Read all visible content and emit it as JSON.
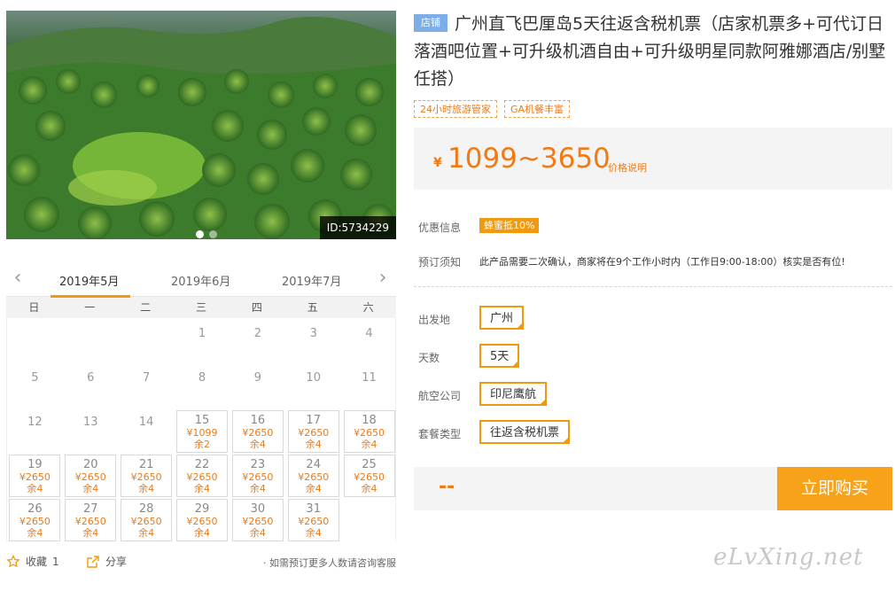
{
  "hero": {
    "image_id": "ID:5734229",
    "dot_count": 2,
    "active_dot": 1
  },
  "calendar": {
    "months": [
      "2019年5月",
      "2019年6月",
      "2019年7月"
    ],
    "active_month": 0,
    "weekdays": [
      "日",
      "一",
      "二",
      "三",
      "四",
      "五",
      "六"
    ],
    "days": [
      {
        "d": "1"
      },
      {
        "d": "2"
      },
      {
        "d": "3"
      },
      {
        "d": "4"
      },
      {
        "d": "5"
      },
      {
        "d": "6"
      },
      {
        "d": "7"
      },
      {
        "d": "8"
      },
      {
        "d": "9"
      },
      {
        "d": "10"
      },
      {
        "d": "11"
      },
      {
        "d": "12"
      },
      {
        "d": "13"
      },
      {
        "d": "14"
      },
      {
        "d": "15",
        "price": "¥1099",
        "remain": "余2"
      },
      {
        "d": "16",
        "price": "¥2650",
        "remain": "余4"
      },
      {
        "d": "17",
        "price": "¥2650",
        "remain": "余4"
      },
      {
        "d": "18",
        "price": "¥2650",
        "remain": "余4"
      },
      {
        "d": "19",
        "price": "¥2650",
        "remain": "余4"
      },
      {
        "d": "20",
        "price": "¥2650",
        "remain": "余4"
      },
      {
        "d": "21",
        "price": "¥2650",
        "remain": "余4"
      },
      {
        "d": "22",
        "price": "¥2650",
        "remain": "余4"
      },
      {
        "d": "23",
        "price": "¥2650",
        "remain": "余4"
      },
      {
        "d": "24",
        "price": "¥2650",
        "remain": "余4"
      },
      {
        "d": "25",
        "price": "¥2650",
        "remain": "余4"
      },
      {
        "d": "26",
        "price": "¥2650",
        "remain": "余4"
      },
      {
        "d": "27",
        "price": "¥2650",
        "remain": "余4"
      },
      {
        "d": "28",
        "price": "¥2650",
        "remain": "余4"
      },
      {
        "d": "29",
        "price": "¥2650",
        "remain": "余4"
      },
      {
        "d": "30",
        "price": "¥2650",
        "remain": "余4"
      },
      {
        "d": "31",
        "price": "¥2650",
        "remain": "余4"
      }
    ],
    "first_weekday": 3,
    "footer": {
      "favorite_label": "收藏",
      "favorite_count": "1",
      "share_label": "分享",
      "note": "· 如需预订更多人数请咨询客服"
    }
  },
  "product": {
    "shop_tag": "店铺",
    "title": "广州直飞巴厘岛5天往返含税机票（店家机票多+可代订日落酒吧位置+可升级机酒自由+可升级明星同款阿雅娜酒店/别墅任搭）",
    "feature_tags": [
      "24小时旅游管家",
      "GA机餐丰富"
    ],
    "price_symbol": "¥",
    "price": "1099~3650",
    "price_explain": "价格说明",
    "discount_label": "优惠信息",
    "discount_badge": "蜂蜜抵10%",
    "booking_label": "预订须知",
    "booking_text": "此产品需要二次确认，商家将在9个工作小时内（工作日9:00-18:00）核实是否有位!",
    "options": [
      {
        "label": "出发地",
        "value": "广州"
      },
      {
        "label": "天数",
        "value": "5天"
      },
      {
        "label": "航空公司",
        "value": "印尼鹰航"
      },
      {
        "label": "套餐类型",
        "value": "往返含税机票"
      }
    ],
    "total": "--",
    "buy_label": "立即购买"
  },
  "watermark": "eLvXing.net",
  "colors": {
    "accent": "#f29a0f",
    "price": "#f27a14",
    "shop_tag": "#7eaee8"
  }
}
